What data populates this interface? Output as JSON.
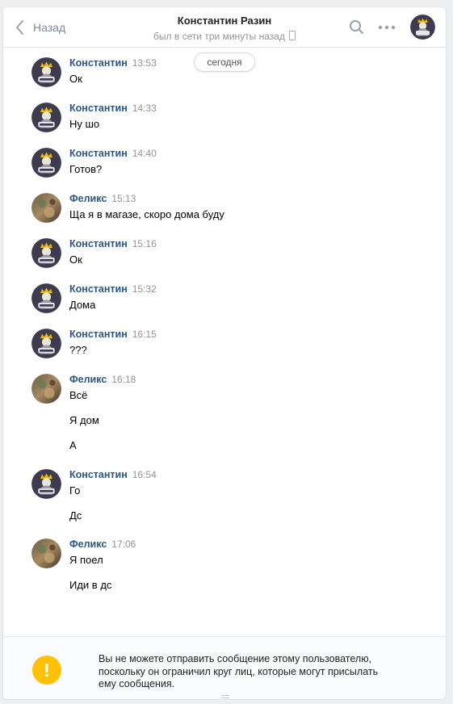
{
  "header": {
    "back_label": "Назад",
    "title": "Константин Разин",
    "status": "был в сети три минуты назад"
  },
  "date_pill": "сегодня",
  "messages": [
    {
      "author": "Константин",
      "time": "13:53",
      "avatar": "king-avatar",
      "lines": [
        "Ок"
      ]
    },
    {
      "author": "Константин",
      "time": "14:33",
      "avatar": "king-avatar",
      "lines": [
        "Ну шо"
      ]
    },
    {
      "author": "Константин",
      "time": "14:40",
      "avatar": "king-avatar",
      "lines": [
        "Готов?"
      ]
    },
    {
      "author": "Феликс",
      "time": "15:13",
      "avatar": "photo-avatar",
      "lines": [
        "Ща я в магазе, скоро дома буду"
      ]
    },
    {
      "author": "Константин",
      "time": "15:16",
      "avatar": "king-avatar",
      "lines": [
        "Ок"
      ]
    },
    {
      "author": "Константин",
      "time": "15:32",
      "avatar": "king-avatar",
      "lines": [
        "Дома"
      ]
    },
    {
      "author": "Константин",
      "time": "16:15",
      "avatar": "king-avatar",
      "lines": [
        "???"
      ]
    },
    {
      "author": "Феликс",
      "time": "16:18",
      "avatar": "photo-avatar",
      "lines": [
        "Всё",
        "Я дом",
        "А"
      ]
    },
    {
      "author": "Константин",
      "time": "16:54",
      "avatar": "king-avatar",
      "lines": [
        "Го",
        "Дс"
      ]
    },
    {
      "author": "Феликс",
      "time": "17:06",
      "avatar": "photo-avatar",
      "lines": [
        "Я поел",
        "Иди в дс"
      ]
    }
  ],
  "footer": {
    "notice_line1": "Вы не можете отправить сообщение этому пользователю,",
    "notice_line2": "поскольку он ограничил круг лиц, которые могут присылать",
    "notice_line3": "ему сообщения.",
    "icon_glyph": "!"
  },
  "colors": {
    "author_name": "#2a5885",
    "warning": "#ffc107"
  }
}
